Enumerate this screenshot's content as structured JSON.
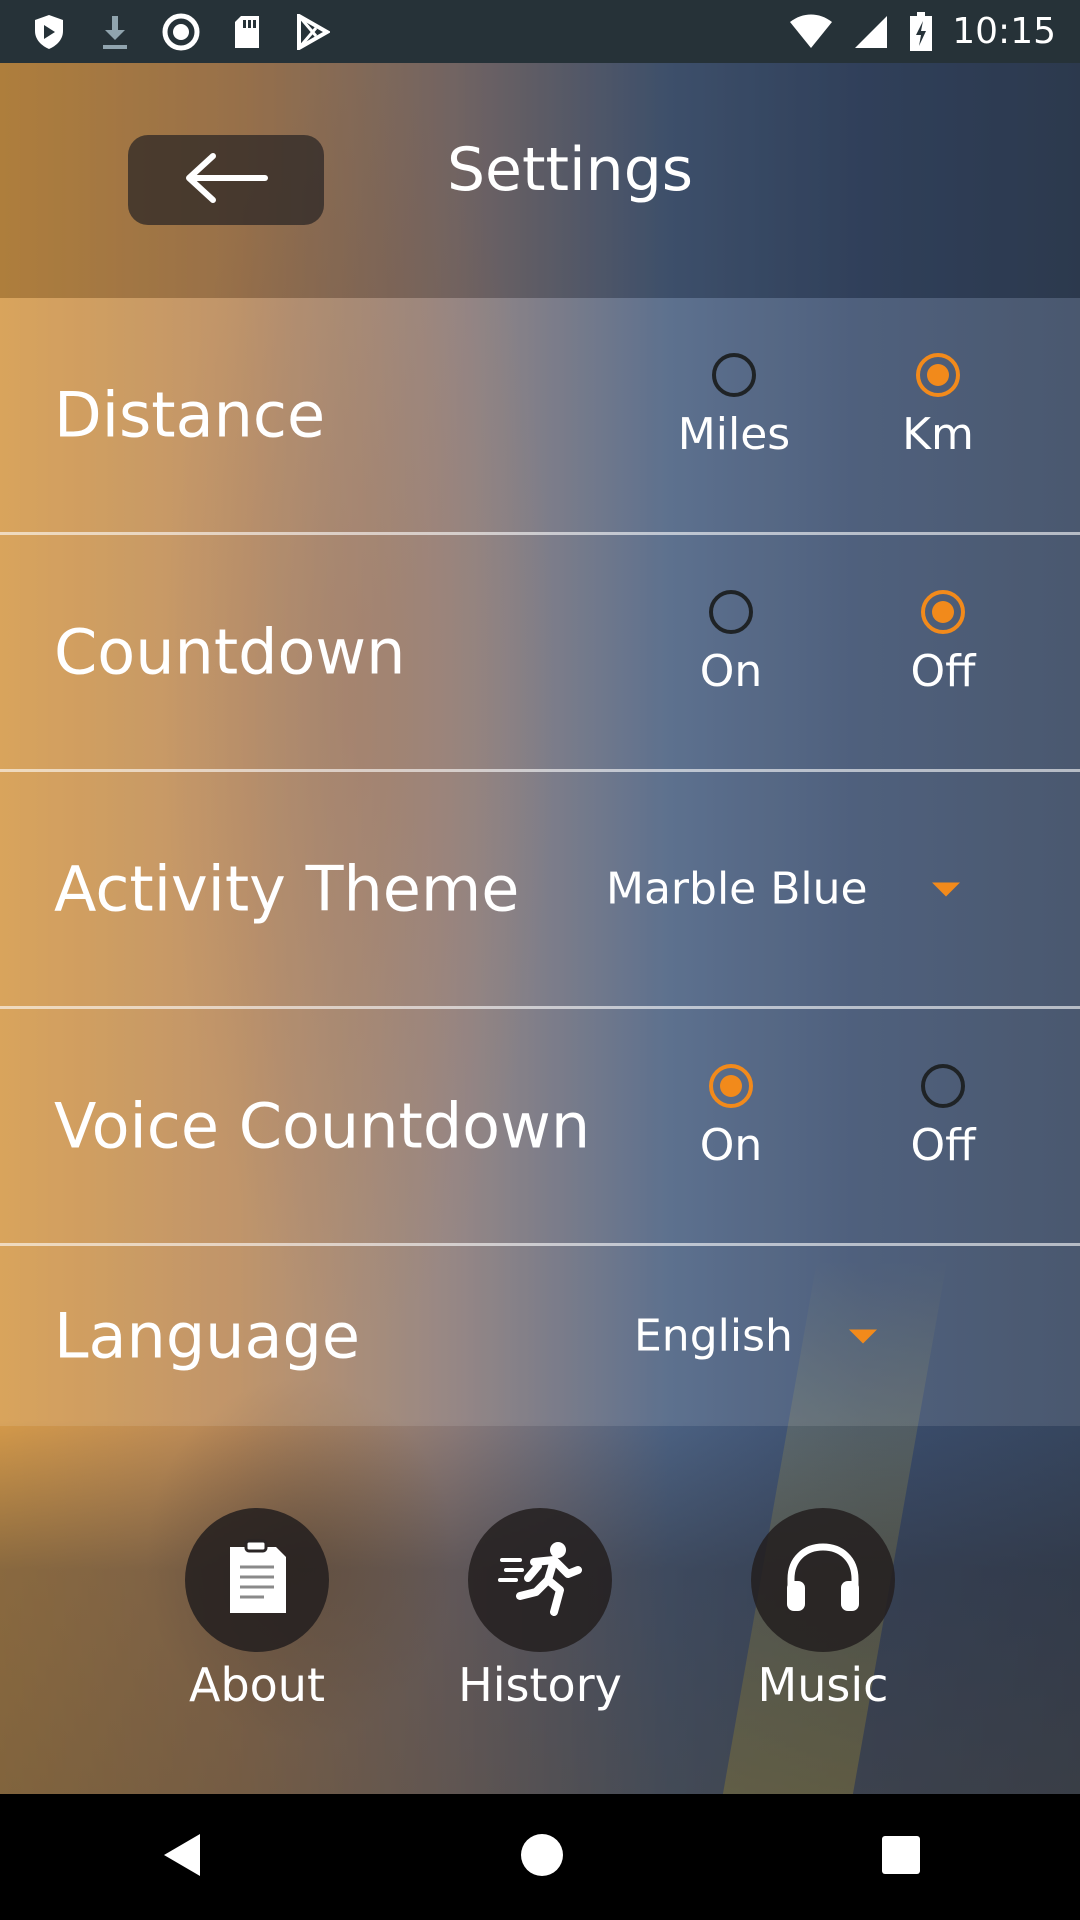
{
  "status_bar": {
    "time": "10:15",
    "left_icons": [
      "shield-icon",
      "download-icon",
      "record-icon",
      "sd-card-icon",
      "play-store-icon"
    ],
    "right_icons": [
      "wifi-icon",
      "signal-icon",
      "battery-charging-icon"
    ]
  },
  "header": {
    "title": "Settings",
    "back_icon": "arrow-left-icon"
  },
  "settings": {
    "distance": {
      "label": "Distance",
      "options": [
        {
          "label": "Miles",
          "selected": false
        },
        {
          "label": "Km",
          "selected": true
        }
      ]
    },
    "countdown": {
      "label": "Countdown",
      "options": [
        {
          "label": "On",
          "selected": false
        },
        {
          "label": "Off",
          "selected": true
        }
      ]
    },
    "activity_theme": {
      "label": "Activity Theme",
      "value": "Marble Blue"
    },
    "voice_countdown": {
      "label": "Voice Countdown",
      "options": [
        {
          "label": "On",
          "selected": true
        },
        {
          "label": "Off",
          "selected": false
        }
      ]
    },
    "language": {
      "label": "Language",
      "value": "English"
    }
  },
  "bottom_nav": {
    "items": [
      {
        "label": "About",
        "icon": "document-icon"
      },
      {
        "label": "History",
        "icon": "runner-icon"
      },
      {
        "label": "Music",
        "icon": "headphones-icon"
      }
    ]
  },
  "colors": {
    "accent": "#f28a1b",
    "status_bar": "#263238"
  }
}
